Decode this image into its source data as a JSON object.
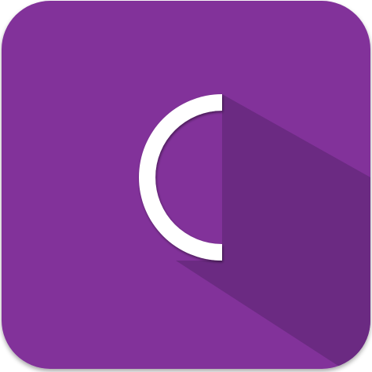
{
  "icon": {
    "name": "app-icon",
    "shape": "rounded-square",
    "glyph": "arc-c-icon",
    "colors": {
      "background": "#82309A",
      "long_shadow": "#6B2A82",
      "drop_shadow": "#4A1A5E",
      "glyph": "#FFFFFF"
    }
  }
}
